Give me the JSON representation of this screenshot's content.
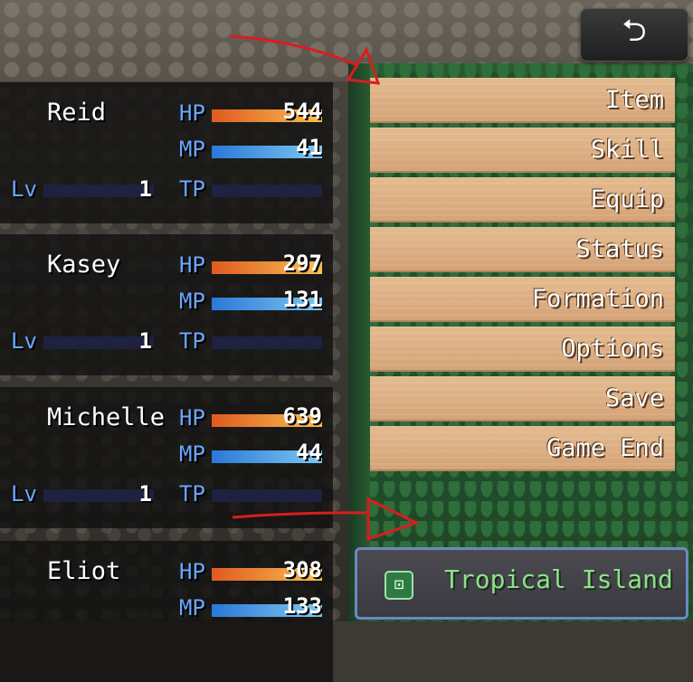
{
  "back_button": {
    "icon": "undo-arrow-icon",
    "glyph": "⮌"
  },
  "party": [
    {
      "name": "Reid",
      "level": "1",
      "hp": "544",
      "mp": "41",
      "hp_fill": 1.0,
      "mp_fill": 1.0,
      "tp_fill": 0.0
    },
    {
      "name": "Kasey",
      "level": "1",
      "hp": "297",
      "mp": "131",
      "hp_fill": 1.0,
      "mp_fill": 1.0,
      "tp_fill": 0.0
    },
    {
      "name": "Michelle",
      "level": "1",
      "hp": "639",
      "mp": "44",
      "hp_fill": 1.0,
      "mp_fill": 1.0,
      "tp_fill": 0.0
    },
    {
      "name": "Eliot",
      "level": "1",
      "hp": "308",
      "mp": "133",
      "hp_fill": 1.0,
      "mp_fill": 1.0,
      "tp_fill": 0.0
    }
  ],
  "labels": {
    "hp": "HP",
    "mp": "MP",
    "tp": "TP",
    "lv": "Lv"
  },
  "menu": {
    "commands": [
      "Item",
      "Skill",
      "Equip",
      "Status",
      "Formation",
      "Options",
      "Save",
      "Game End"
    ]
  },
  "location": {
    "icon": "map-scroll-icon",
    "glyph": "⊡",
    "name": "Tropical Island"
  },
  "colors": {
    "annotation": "#d81e1e",
    "location_text": "#8ee08a",
    "label": "#6aa6ff"
  }
}
